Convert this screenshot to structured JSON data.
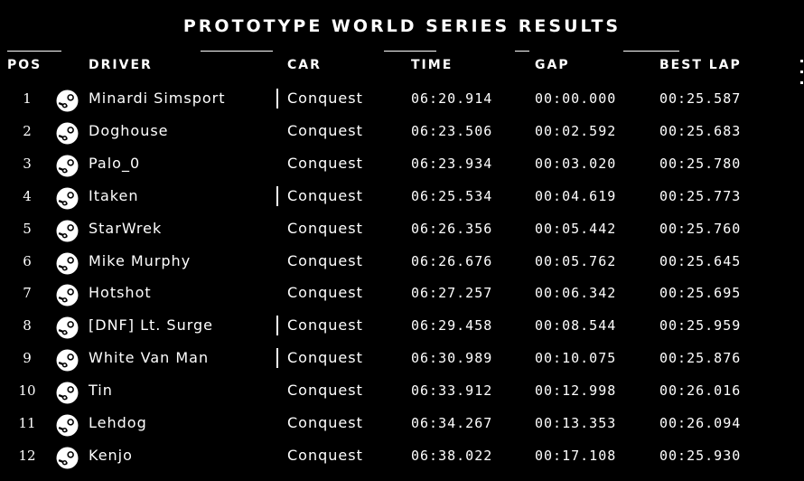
{
  "title": "PROTOTYPE WORLD SERIES RESULTS",
  "headers": {
    "pos": "POS",
    "driver": "DRIVER",
    "car": "CAR",
    "time": "TIME",
    "gap": "GAP",
    "best_lap": "BEST LAP"
  },
  "rows": [
    {
      "pos": "1",
      "driver": "Minardi Simsport",
      "car": "Conquest",
      "time": "06:20.914",
      "gap": "00:00.000",
      "best_lap": "00:25.587",
      "icon": "steam-icon",
      "marker": true
    },
    {
      "pos": "2",
      "driver": "Doghouse",
      "car": "Conquest",
      "time": "06:23.506",
      "gap": "00:02.592",
      "best_lap": "00:25.683",
      "icon": "steam-icon",
      "marker": false
    },
    {
      "pos": "3",
      "driver": "Palo_0",
      "car": "Conquest",
      "time": "06:23.934",
      "gap": "00:03.020",
      "best_lap": "00:25.780",
      "icon": "steam-icon",
      "marker": false
    },
    {
      "pos": "4",
      "driver": "Itaken",
      "car": "Conquest",
      "time": "06:25.534",
      "gap": "00:04.619",
      "best_lap": "00:25.773",
      "icon": "steam-icon",
      "marker": true
    },
    {
      "pos": "5",
      "driver": "StarWrek",
      "car": "Conquest",
      "time": "06:26.356",
      "gap": "00:05.442",
      "best_lap": "00:25.760",
      "icon": "steam-icon",
      "marker": false
    },
    {
      "pos": "6",
      "driver": "Mike Murphy",
      "car": "Conquest",
      "time": "06:26.676",
      "gap": "00:05.762",
      "best_lap": "00:25.645",
      "icon": "steam-icon",
      "marker": false
    },
    {
      "pos": "7",
      "driver": "Hotshot",
      "car": "Conquest",
      "time": "06:27.257",
      "gap": "00:06.342",
      "best_lap": "00:25.695",
      "icon": "steam-icon",
      "marker": false
    },
    {
      "pos": "8",
      "driver": "[DNF] Lt. Surge",
      "car": "Conquest",
      "time": "06:29.458",
      "gap": "00:08.544",
      "best_lap": "00:25.959",
      "icon": "steam-icon",
      "marker": true
    },
    {
      "pos": "9",
      "driver": "White Van Man",
      "car": "Conquest",
      "time": "06:30.989",
      "gap": "00:10.075",
      "best_lap": "00:25.876",
      "icon": "steam-icon",
      "marker": true
    },
    {
      "pos": "10",
      "driver": "Tin",
      "car": "Conquest",
      "time": "06:33.912",
      "gap": "00:12.998",
      "best_lap": "00:26.016",
      "icon": "steam-icon",
      "marker": false
    },
    {
      "pos": "11",
      "driver": "Lehdog",
      "car": "Conquest",
      "time": "06:34.267",
      "gap": "00:13.353",
      "best_lap": "00:26.094",
      "icon": "steam-icon",
      "marker": false
    },
    {
      "pos": "12",
      "driver": "Kenjo",
      "car": "Conquest",
      "time": "06:38.022",
      "gap": "00:17.108",
      "best_lap": "00:25.930",
      "icon": "steam-icon",
      "marker": false
    }
  ],
  "colors": {
    "background": "#000000",
    "text": "#ffffff"
  }
}
